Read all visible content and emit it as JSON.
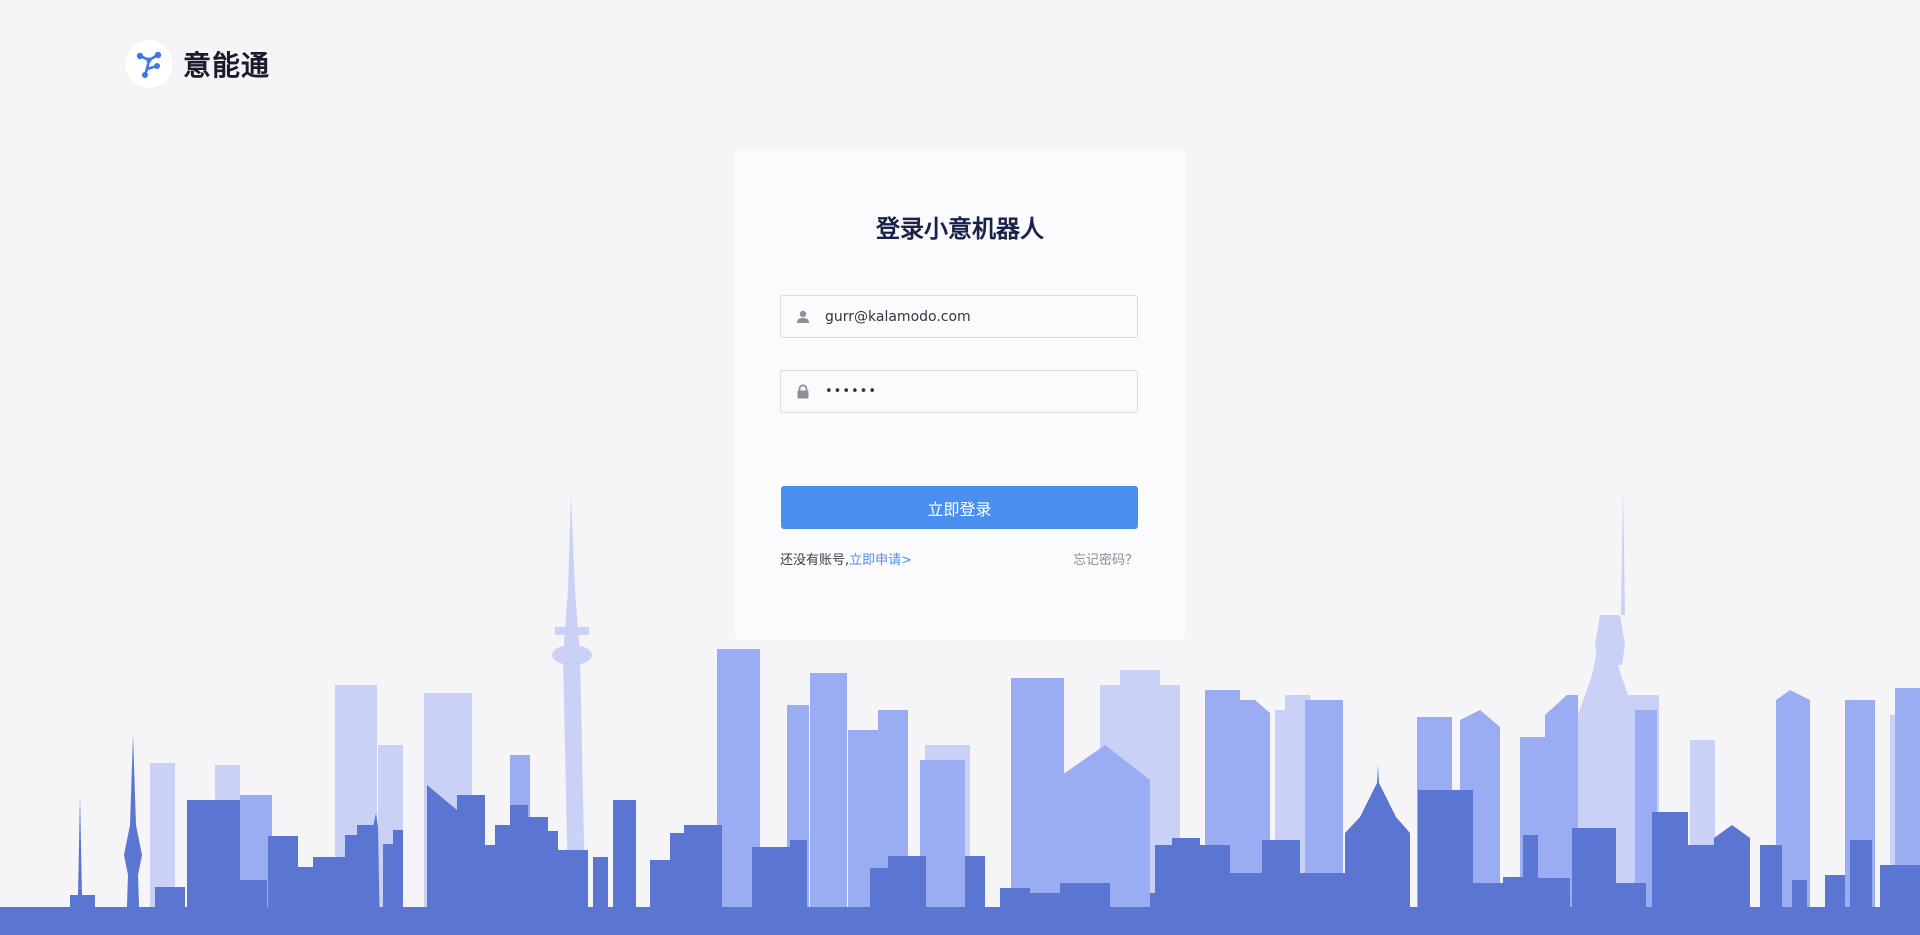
{
  "brand": {
    "name": "意能通",
    "logo_icon": "robot-network-icon",
    "accent_color": "#4a8fef"
  },
  "login": {
    "title": "登录小意机器人",
    "email_icon": "user-icon",
    "email_value": "gurr@kalamodo.com",
    "password_icon": "lock-icon",
    "password_value": "123456",
    "submit_label": "立即登录",
    "no_account_text": "还没有账号,",
    "apply_link_text": "立即申请>",
    "forgot_link_text": "忘记密码？"
  },
  "background": {
    "illustration": "city-skyline",
    "colors": [
      "#c9d2f6",
      "#9aadf2",
      "#5a76d2"
    ]
  }
}
